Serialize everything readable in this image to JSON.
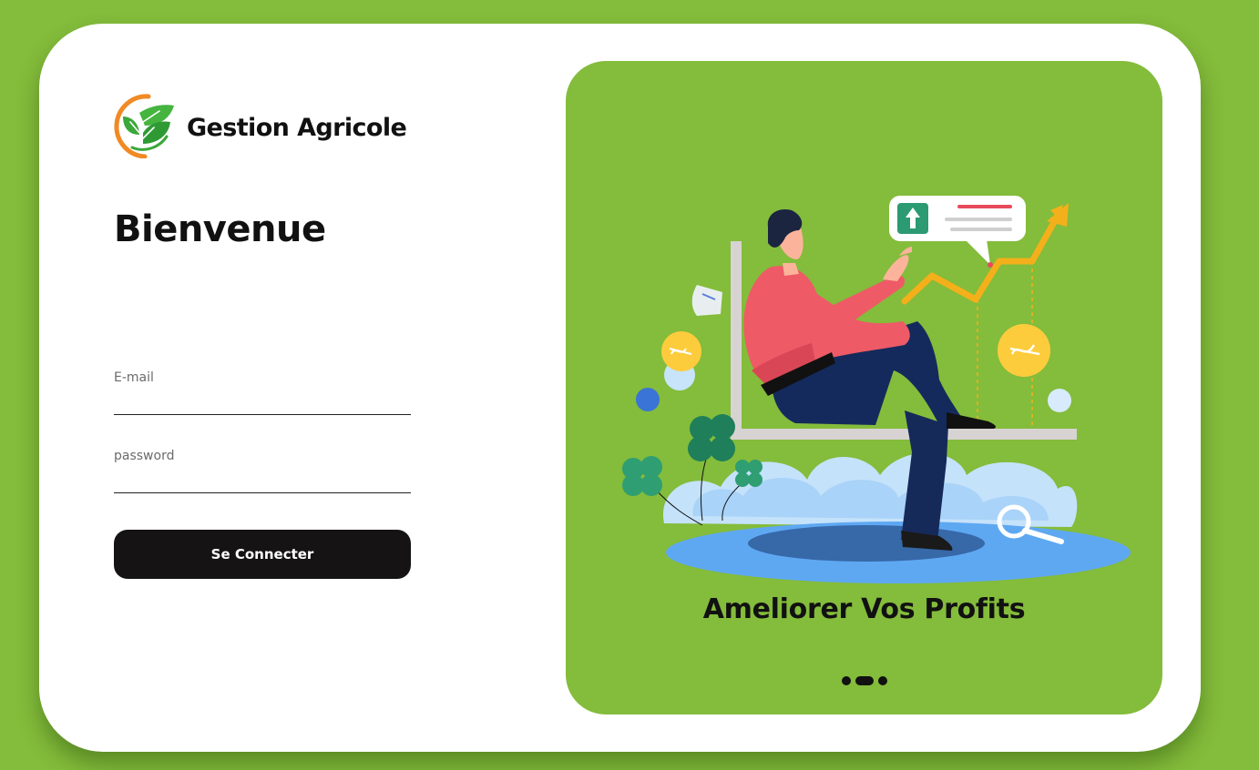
{
  "brand": {
    "name": "Gestion Agricole",
    "logo_icon": "leaf-logo-icon"
  },
  "heading": "Bienvenue",
  "form": {
    "email": {
      "label": "E-mail",
      "value": "",
      "placeholder": ""
    },
    "password": {
      "label": "password",
      "value": "",
      "placeholder": ""
    },
    "submit_label": "Se Connecter"
  },
  "promo": {
    "caption": "Ameliorer Vos Profits",
    "illustration": "man-growth-chart-illustration",
    "slide_count": 3,
    "active_slide": 2
  },
  "colors": {
    "background": "#84bc3b",
    "card": "#ffffff",
    "button": "#151313",
    "accent_orange": "#f08a24",
    "leaf_green": "#3aa83a"
  }
}
